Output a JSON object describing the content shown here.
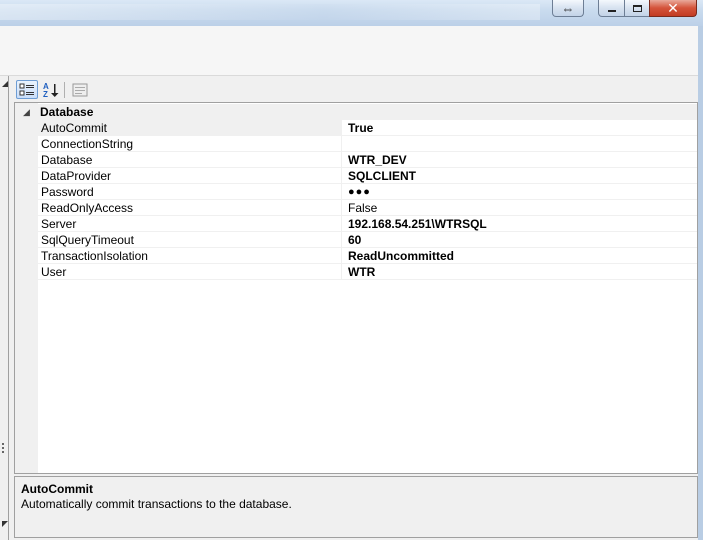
{
  "window": {
    "close_glyph": "✕",
    "minimize_glyph": "▁",
    "maximize_glyph": "▢",
    "restore_glyph": "⇔"
  },
  "property_grid": {
    "category": {
      "label": "Database",
      "toggle": "◢"
    },
    "properties": [
      {
        "name": "AutoCommit",
        "value": "True",
        "bold": true
      },
      {
        "name": "ConnectionString",
        "value": "",
        "bold": false
      },
      {
        "name": "Database",
        "value": "WTR_DEV",
        "bold": true
      },
      {
        "name": "DataProvider",
        "value": "SQLCLIENT",
        "bold": true
      },
      {
        "name": "Password",
        "value": "●●●",
        "bold": true
      },
      {
        "name": "ReadOnlyAccess",
        "value": "False",
        "bold": false
      },
      {
        "name": "Server",
        "value": "192.168.54.251\\WTRSQL",
        "bold": true
      },
      {
        "name": "SqlQueryTimeout",
        "value": "60",
        "bold": true
      },
      {
        "name": "TransactionIsolation",
        "value": "ReadUncommitted",
        "bold": true
      },
      {
        "name": "User",
        "value": "WTR",
        "bold": true
      }
    ],
    "selected_index": 0,
    "description": {
      "title": "AutoCommit",
      "text": "Automatically commit transactions to the database."
    }
  }
}
